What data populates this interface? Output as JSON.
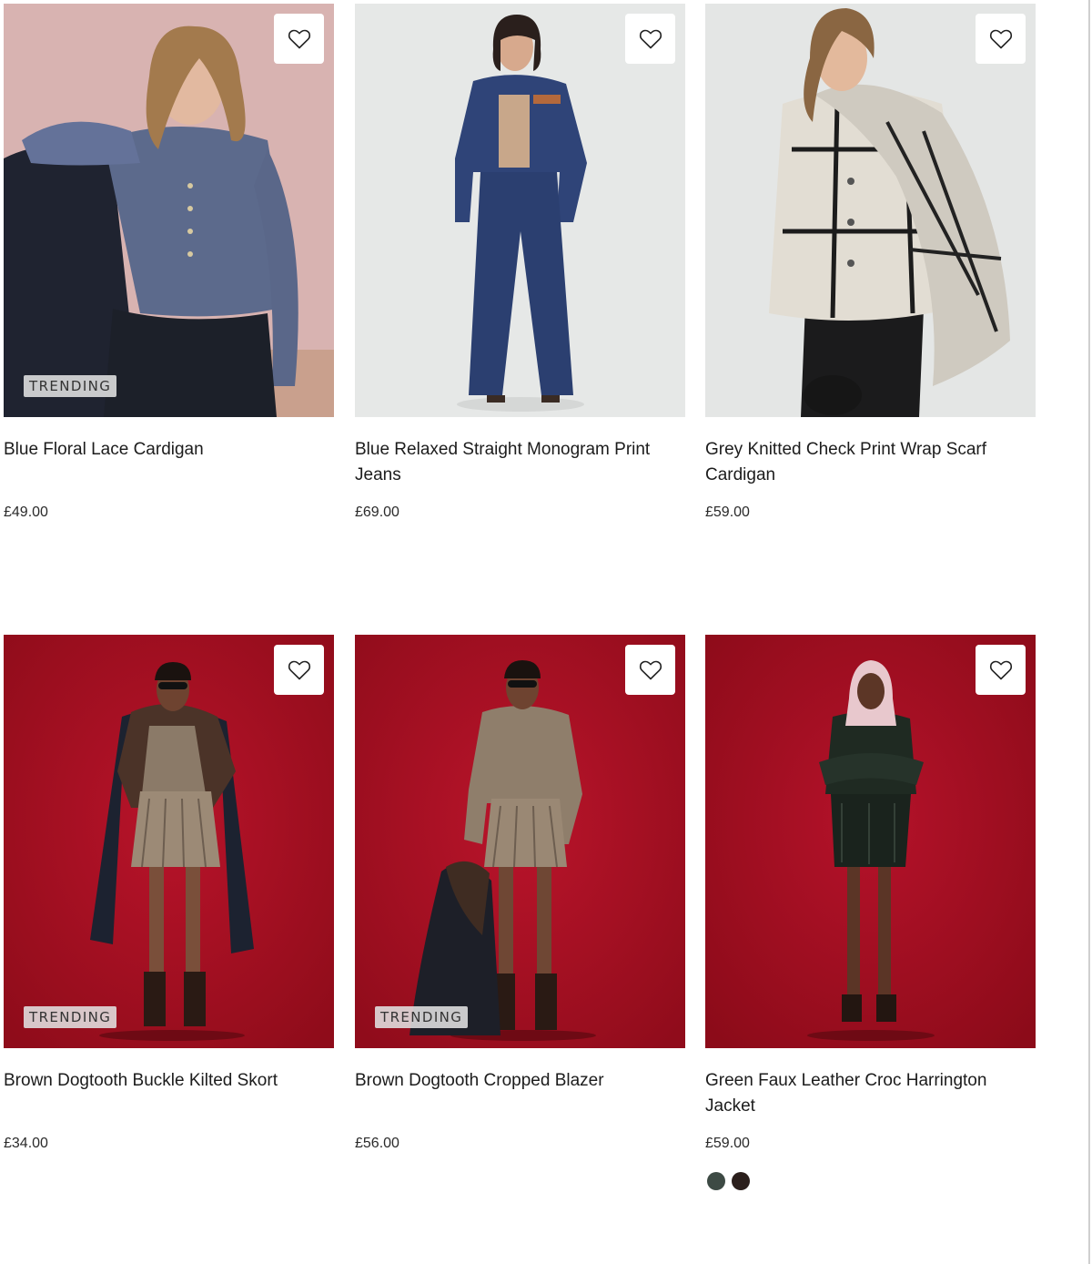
{
  "products": [
    {
      "title": "Blue Floral Lace Cardigan",
      "price": "£49.00",
      "badge": "TRENDING",
      "image_alt": "Blue Floral Lace Cardigan",
      "wishlist_icon": "heart-icon"
    },
    {
      "title": "Blue Relaxed Straight Monogram Print Jeans",
      "price": "£69.00",
      "badge": "",
      "image_alt": "Blue Relaxed Straight Monogram Print Jeans",
      "wishlist_icon": "heart-icon"
    },
    {
      "title": "Grey Knitted Check Print Wrap Scarf Cardigan",
      "price": "£59.00",
      "badge": "",
      "image_alt": "Grey Knitted Check Print Wrap Scarf Cardigan",
      "wishlist_icon": "heart-icon"
    },
    {
      "title": "Brown Dogtooth Buckle Kilted Skort",
      "price": "£34.00",
      "badge": "TRENDING",
      "image_alt": "Brown Dogtooth Buckle Kilted Skort",
      "wishlist_icon": "heart-icon"
    },
    {
      "title": "Brown Dogtooth Cropped Blazer",
      "price": "£56.00",
      "badge": "TRENDING",
      "image_alt": "Brown Dogtooth Cropped Blazer",
      "wishlist_icon": "heart-icon"
    },
    {
      "title": "Green Faux Leather Croc Harrington Jacket",
      "price": "£59.00",
      "badge": "",
      "image_alt": "Green Faux Leather Croc Harrington Jacket",
      "wishlist_icon": "heart-icon",
      "swatches": [
        "#3d4a44",
        "#2b1f1c"
      ]
    }
  ],
  "colors": {
    "background": "#ffffff",
    "text": "#1c1c1c",
    "badge_bg": "#e1e1e1",
    "photo_pink": "#d9b6b4",
    "photo_grey": "#e7e9e8",
    "photo_red": "#a4111f"
  }
}
